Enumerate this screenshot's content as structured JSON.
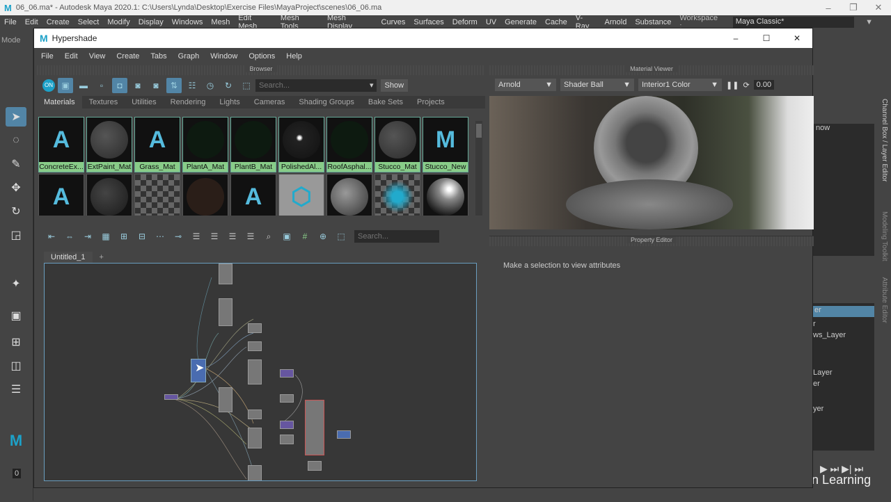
{
  "os_title": "06_06.ma* - Autodesk Maya 2020.1: C:\\Users\\Lynda\\Desktop\\Exercise Files\\MayaProject\\scenes\\06_06.ma",
  "main_menu": [
    "File",
    "Edit",
    "Create",
    "Select",
    "Modify",
    "Display",
    "Windows",
    "Mesh",
    "Edit Mesh",
    "Mesh Tools",
    "Mesh Display",
    "Curves",
    "Surfaces",
    "Deform",
    "UV",
    "Generate",
    "Cache",
    "V-Ray",
    "Arnold",
    "Substance"
  ],
  "workspace": {
    "label": "Workspace :",
    "value": "Maya Classic*"
  },
  "mode_label": "Mode",
  "hypershade": {
    "title": "Hypershade",
    "menu": [
      "File",
      "Edit",
      "View",
      "Create",
      "Tabs",
      "Graph",
      "Window",
      "Options",
      "Help"
    ],
    "browser": {
      "title": "Browser",
      "on_label": "ON",
      "search_placeholder": "Search...",
      "show_label": "Show",
      "tabs": [
        "Materials",
        "Textures",
        "Utilities",
        "Rendering",
        "Lights",
        "Cameras",
        "Shading Groups",
        "Bake Sets",
        "Projects"
      ],
      "materials": [
        "ConcreteEx...",
        "ExtPaint_Mat",
        "Grass_Mat",
        "PlantA_Mat",
        "PlantB_Mat",
        "PolishedAl...",
        "RoofAsphal...",
        "Stucco_Mat",
        "Stucco_New"
      ]
    },
    "material_viewer": {
      "title": "Material Viewer",
      "renderer": "Arnold",
      "shape": "Shader Ball",
      "environment": "Interior1 Color",
      "exposure": "0.00"
    },
    "property_editor": {
      "title": "Property Editor",
      "message": "Make a selection to view attributes"
    },
    "node_editor": {
      "search_placeholder": "Search...",
      "tabs": [
        "Untitled_1"
      ],
      "add_tab": "+"
    }
  },
  "right_panel": {
    "vertical_tabs": [
      "Channel Box / Layer Editor",
      "Modeling Toolkit",
      "Attribute Editor"
    ],
    "layer_fragments": [
      "now",
      "er",
      "r",
      "ws_Layer",
      "Layer",
      "er",
      "yer"
    ]
  },
  "timeline": {
    "frame": "0"
  },
  "watermark": "LinkedIn Learning"
}
